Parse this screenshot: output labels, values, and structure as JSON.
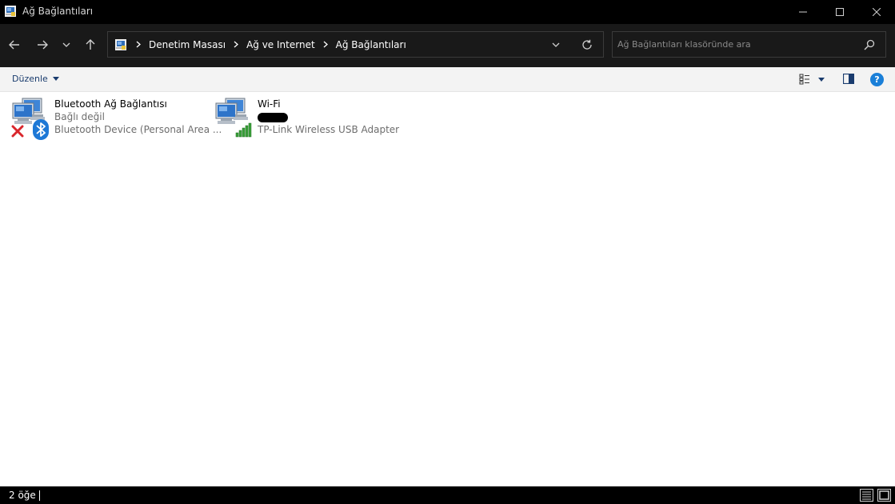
{
  "window": {
    "title": "Ağ Bağlantıları",
    "controls": [
      "minimize",
      "maximize",
      "close"
    ]
  },
  "nav": {
    "breadcrumbs": [
      "Denetim Masası",
      "Ağ ve Internet",
      "Ağ Bağlantıları"
    ],
    "search_placeholder": "Ağ Bağlantıları klasöründe ara"
  },
  "commandbar": {
    "organize_label": "Düzenle",
    "help_label": "?"
  },
  "connections": [
    {
      "name": "Bluetooth Ağ Bağlantısı",
      "status": "Bağlı değil",
      "device": "Bluetooth Device (Personal Area ...",
      "badge": "bluetooth-icon",
      "state_icon": "disconnected-x-icon"
    },
    {
      "name": "Wi-Fi",
      "status": "",
      "device": "TP-Link Wireless USB Adapter",
      "badge": "wifi-signal-icon",
      "status_redacted": true
    }
  ],
  "statusbar": {
    "item_count": "2 öğe"
  },
  "colors": {
    "titlebar_bg": "#000000",
    "navbar_bg": "#191919",
    "commandbar_bg": "#f3f3f3",
    "link_blue": "#1a3c6e",
    "help_blue": "#1a7fd8",
    "signal_green": "#3aa03a",
    "error_red": "#d9262c"
  }
}
